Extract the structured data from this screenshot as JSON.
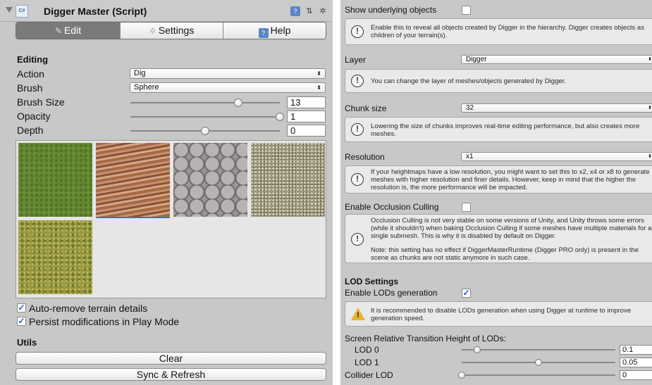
{
  "left": {
    "header": {
      "title": "Digger Master (Script)",
      "script_icon": "C#"
    },
    "tabs": [
      {
        "label": "Edit",
        "icon": "brush-icon"
      },
      {
        "label": "Settings",
        "icon": "gear-icon"
      },
      {
        "label": "Help",
        "icon": "book-icon"
      }
    ],
    "editing": {
      "title": "Editing",
      "action": {
        "label": "Action",
        "value": "Dig"
      },
      "brush": {
        "label": "Brush",
        "value": "Sphere"
      },
      "brush_size": {
        "label": "Brush Size",
        "value": "13",
        "fraction": 0.72
      },
      "opacity": {
        "label": "Opacity",
        "value": "1",
        "fraction": 1.0
      },
      "depth": {
        "label": "Depth",
        "value": "0",
        "fraction": 0.5
      }
    },
    "textures": [
      "grass",
      "wood",
      "stone",
      "gravel",
      "meadow"
    ],
    "auto_remove": {
      "label": "Auto-remove terrain details",
      "checked": true
    },
    "persist": {
      "label": "Persist modifications in Play Mode",
      "checked": true
    },
    "utils": {
      "title": "Utils",
      "clear": "Clear",
      "sync": "Sync & Refresh"
    }
  },
  "right": {
    "show_underlying": {
      "label": "Show underlying objects",
      "help": "Enable this to reveal all objects created by Digger in the hierarchy. Digger creates objects as children of your terrain(s)."
    },
    "layer": {
      "label": "Layer",
      "value": "Digger",
      "help": "You can change the layer of meshes/objects generated by Digger."
    },
    "chunk_size": {
      "label": "Chunk size",
      "value": "32",
      "help": "Lowering the size of chunks improves real-time editing performance, but also creates more meshes."
    },
    "resolution": {
      "label": "Resolution",
      "value": "x1",
      "help": "If your heightmaps have a low resolution, you might want to set this to x2, x4 or x8 to generate meshes with higher resolution and finer details. However, keep in mind that the higher the resolution is, the more performance will be impacted."
    },
    "occlusion": {
      "label": "Enable Occlusion Culling",
      "help1": "Occlusion Culling is not very stable on some versions of Unity, and Unity throws some errors (while it shouldn't) when baking Occlusion Culling if some meshes have multiple materials for a single submesh. This is why it is disabled by default on Digger.",
      "help2": "Note: this setting has no effect if DiggerMasterRuntime (Digger PRO only) is present in the scene as chunks are not static anymore in such case."
    },
    "lod": {
      "title": "LOD Settings",
      "enable_label": "Enable LODs generation",
      "enable_checked": true,
      "warning": "It is recommended to disable LODs generation when using Digger at runtime to improve generation speed.",
      "transition_title": "Screen Relative Transition Height of LODs:",
      "lod0": {
        "label": "LOD 0",
        "value": "0.1",
        "fraction": 0.1
      },
      "lod1": {
        "label": "LOD 1",
        "value": "0.05",
        "fraction": 0.5
      },
      "collider": {
        "label": "Collider LOD",
        "value": "0",
        "fraction": 0.0
      }
    }
  }
}
